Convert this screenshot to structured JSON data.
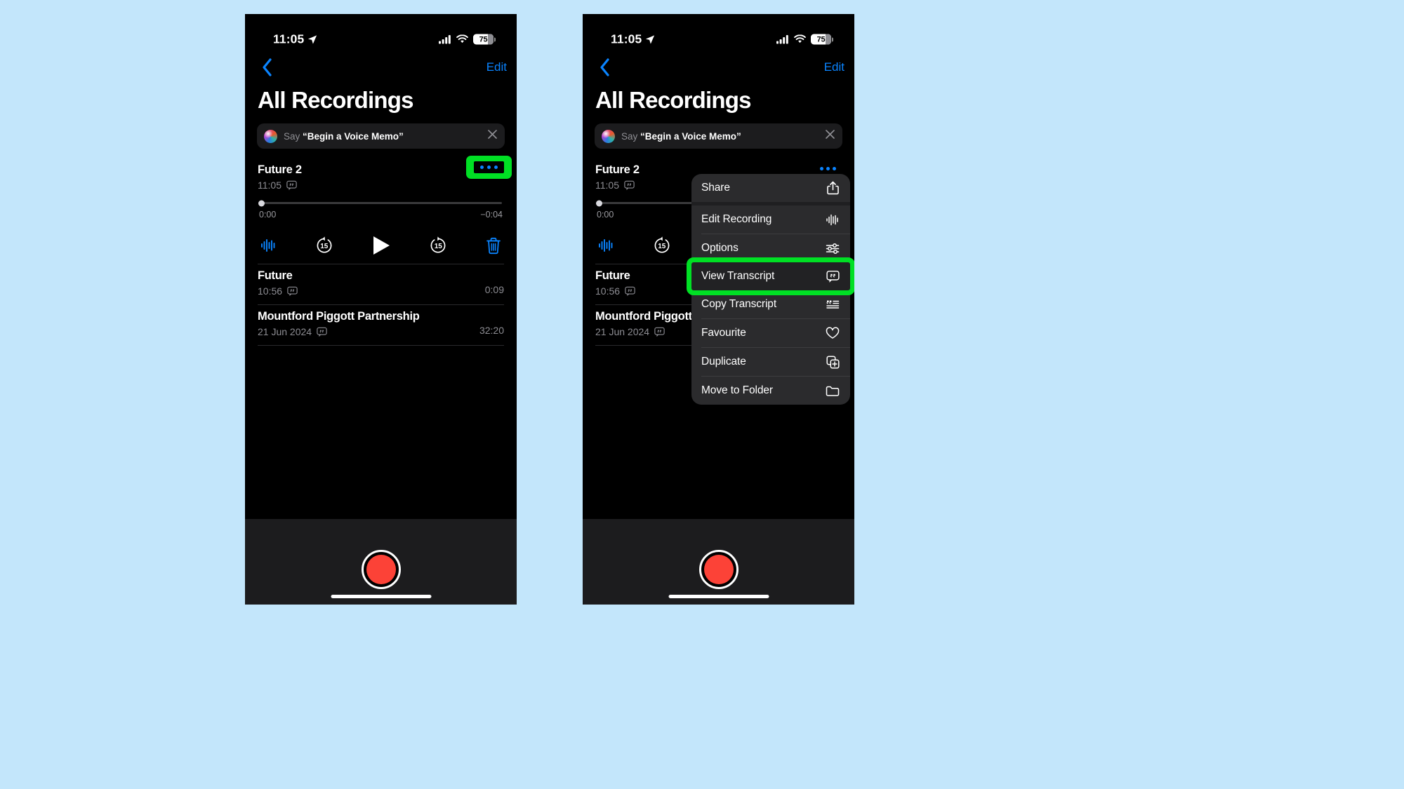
{
  "meta": {
    "background_color": "#c3e6fb",
    "accent_blue": "#0a84ff",
    "highlight_green": "#00e024",
    "record_red": "#fc4237",
    "screen_black": "#000000",
    "panel_gray": "#1c1c1e",
    "menu_gray": "#2b2b2d"
  },
  "status_bar": {
    "time": "11:05",
    "location_icon": "location-arrow-icon",
    "cellular_icon": "cellular-bars-icon",
    "wifi_icon": "wifi-icon",
    "battery_icon": "battery-icon",
    "battery_level": "75"
  },
  "nav": {
    "back_icon": "chevron-left-icon",
    "edit_label": "Edit"
  },
  "header": {
    "title": "All Recordings"
  },
  "siri": {
    "orb_icon": "siri-orb-icon",
    "prefix": "Say ",
    "quote": "“Begin a Voice Memo”",
    "close_icon": "close-icon"
  },
  "recordings": [
    {
      "name": "Future 2",
      "date": "11:05",
      "transcript_icon": "transcript-quote-icon",
      "duration": "",
      "expanded": true,
      "more_icon": "more-ellipsis-icon"
    },
    {
      "name": "Future",
      "date": "10:56",
      "transcript_icon": "transcript-quote-icon",
      "duration": "0:09",
      "expanded": false
    },
    {
      "name": "Mountford Piggott Partnership",
      "date": "21 Jun 2024",
      "transcript_icon": "transcript-quote-icon",
      "duration": "32:20",
      "expanded": false
    }
  ],
  "player": {
    "elapsed": "0:00",
    "remaining": "−0:04",
    "progress_percent": 0,
    "waveform_icon": "waveform-icon",
    "skip_back_icon": "skip-back-15-icon",
    "skip_back_label": "15",
    "play_icon": "play-icon",
    "skip_forward_icon": "skip-forward-15-icon",
    "skip_forward_label": "15",
    "delete_icon": "trash-icon"
  },
  "footer": {
    "record_icon": "record-button-icon",
    "home_indicator": "home-indicator"
  },
  "context_menu": {
    "items": [
      {
        "label": "Share",
        "icon": "share-icon",
        "highlighted": false
      },
      {
        "label": "Edit Recording",
        "icon": "waveform-icon",
        "highlighted": false
      },
      {
        "label": "Options",
        "icon": "sliders-icon",
        "highlighted": false
      },
      {
        "label": "View Transcript",
        "icon": "transcript-quote-icon",
        "highlighted": true
      },
      {
        "label": "Copy Transcript",
        "icon": "copy-transcript-icon",
        "highlighted": false
      },
      {
        "label": "Favourite",
        "icon": "heart-icon",
        "highlighted": false
      },
      {
        "label": "Duplicate",
        "icon": "duplicate-icon",
        "highlighted": false
      },
      {
        "label": "Move to Folder",
        "icon": "folder-icon",
        "highlighted": false
      }
    ]
  }
}
